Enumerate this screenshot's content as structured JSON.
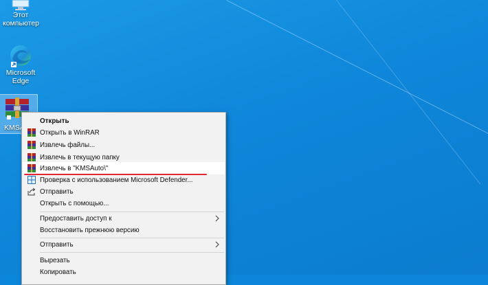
{
  "desktop": {
    "icons": [
      {
        "label_line1": "Этот",
        "label_line2": "компьютер"
      },
      {
        "label_line1": "Microsoft",
        "label_line2": "Edge"
      },
      {
        "label": "KMSA"
      }
    ]
  },
  "context_menu": {
    "items": [
      {
        "label": "Открыть",
        "icon": "none",
        "bold": true
      },
      {
        "label": "Открыть в WinRAR",
        "icon": "winrar-icon"
      },
      {
        "label": "Извлечь файлы...",
        "icon": "winrar-icon"
      },
      {
        "label": "Извлечь в текущую папку",
        "icon": "winrar-icon"
      },
      {
        "label": "Извлечь в \"KMSAuto\\\"",
        "icon": "winrar-icon",
        "highlighted": true
      },
      {
        "label": "Проверка с использованием Microsoft Defender...",
        "icon": "defender-icon"
      },
      {
        "label": "Отправить",
        "icon": "share-icon"
      },
      {
        "label": "Открыть с помощью...",
        "icon": "none"
      },
      {
        "label": "Предоставить доступ к",
        "icon": "none",
        "submenu": true
      },
      {
        "label": "Восстановить прежнюю версию",
        "icon": "none"
      },
      {
        "label": "Отправить",
        "icon": "none",
        "submenu": true
      },
      {
        "label": "Вырезать",
        "icon": "none"
      },
      {
        "label": "Копировать",
        "icon": "none"
      }
    ]
  },
  "colors": {
    "desktop_blue": "#0c86d8",
    "menu_bg": "#f2f2f2",
    "annotation_red": "#e3262e"
  }
}
